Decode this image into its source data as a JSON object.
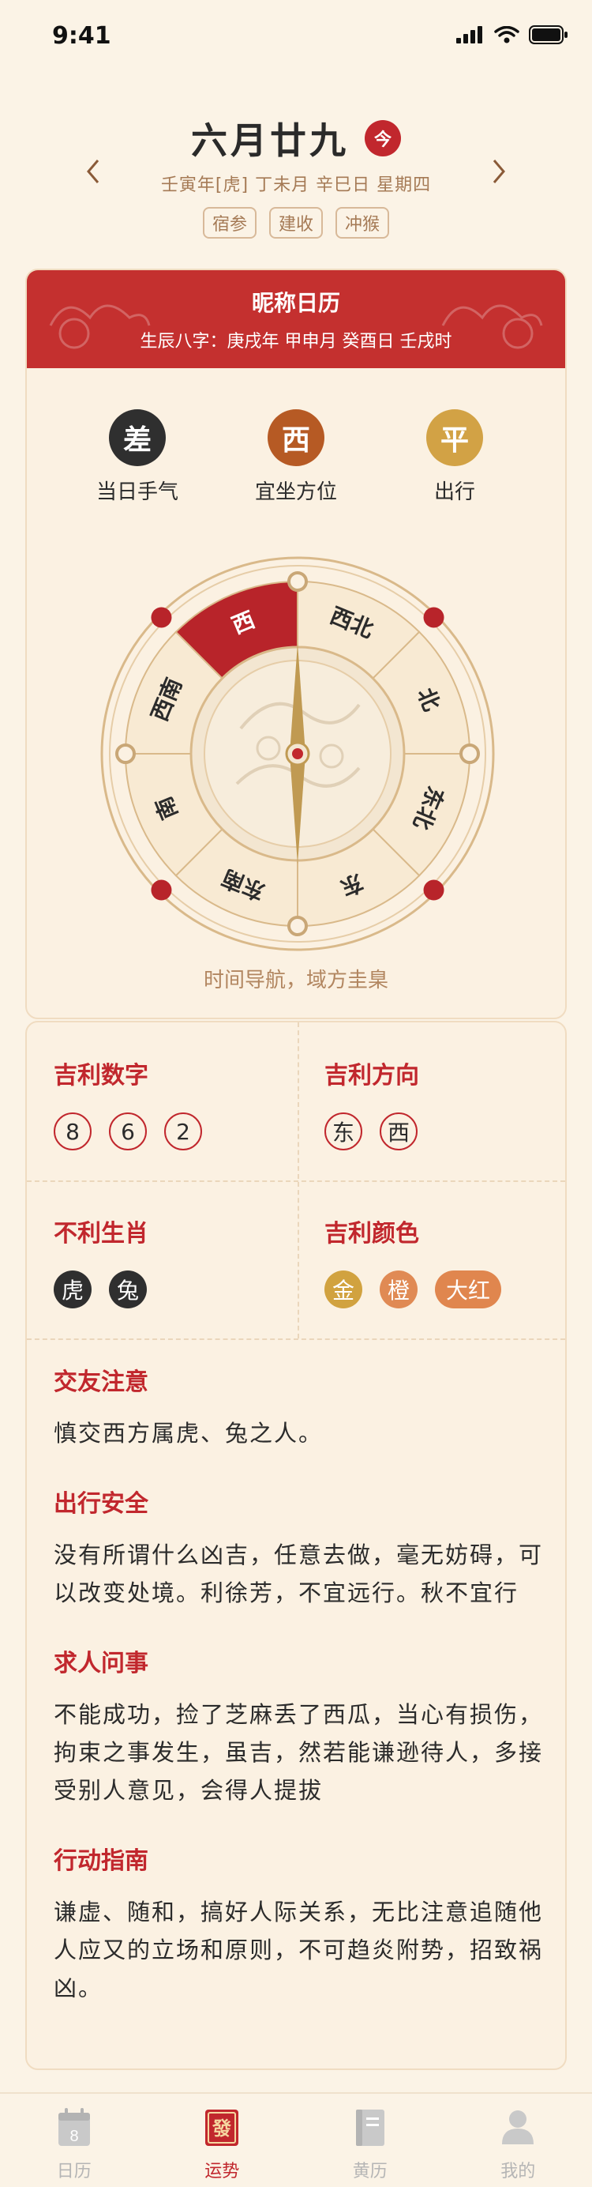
{
  "status": {
    "time": "9:41"
  },
  "header": {
    "date_title": "六月廿九",
    "today_badge": "今",
    "lunar_line": "壬寅年[虎]  丁未月  辛巳日  星期四",
    "tags": [
      "宿参",
      "建收",
      "冲猴"
    ],
    "prev_icon": "chevron-left-icon",
    "next_icon": "chevron-right-icon"
  },
  "card": {
    "title": "昵称日历",
    "bazi": "生辰八字：庚戌年  甲申月  癸酉日  壬戌时",
    "stats": [
      {
        "symbol": "差",
        "label": "当日手气",
        "color": "#2f2f2f"
      },
      {
        "symbol": "西",
        "label": "宜坐方位",
        "color": "#b65a24"
      },
      {
        "symbol": "平",
        "label": "出行",
        "color": "#d2a245"
      }
    ],
    "compass": {
      "directions": [
        "西北",
        "北",
        "东北",
        "东",
        "东南",
        "南",
        "西南",
        "西"
      ],
      "highlighted": "西"
    },
    "caption": "时间导航，域方圭臬"
  },
  "grid": {
    "lucky_numbers": {
      "title": "吉利数字",
      "items": [
        "8",
        "6",
        "2"
      ]
    },
    "lucky_directions": {
      "title": "吉利方向",
      "items": [
        "东",
        "西"
      ]
    },
    "unlucky_zodiac": {
      "title": "不利生肖",
      "items": [
        "虎",
        "兔"
      ]
    },
    "lucky_colors": {
      "title": "吉利颜色",
      "items": [
        {
          "name": "金",
          "color": "#d1a23f"
        },
        {
          "name": "橙",
          "color": "#e08a54"
        },
        {
          "name": "大红",
          "color": "#e0864e"
        }
      ]
    }
  },
  "sections": [
    {
      "title": "交友注意",
      "body": "慎交西方属虎、兔之人。"
    },
    {
      "title": "出行安全",
      "body": "没有所谓什么凶吉，任意去做，毫无妨碍，可以改变处境。利徐芳，不宜远行。秋不宜行"
    },
    {
      "title": "求人问事",
      "body": "不能成功，捡了芝麻丢了西瓜，当心有损伤，拘束之事发生，虽吉，然若能谦逊待人，多接受别人意见，会得人提拔"
    },
    {
      "title": "行动指南",
      "body": "谦虚、随和，搞好人际关系，无比注意追随他人应又的立场和原则，不可趋炎附势，招致祸凶。"
    }
  ],
  "tabbar": [
    {
      "label": "日历",
      "icon": "calendar-icon",
      "icon_text": "8"
    },
    {
      "label": "运势",
      "icon": "fortune-icon",
      "icon_text": "發"
    },
    {
      "label": "黄历",
      "icon": "almanac-book-icon"
    },
    {
      "label": "我的",
      "icon": "profile-icon"
    }
  ],
  "tabbar_active": "运势"
}
